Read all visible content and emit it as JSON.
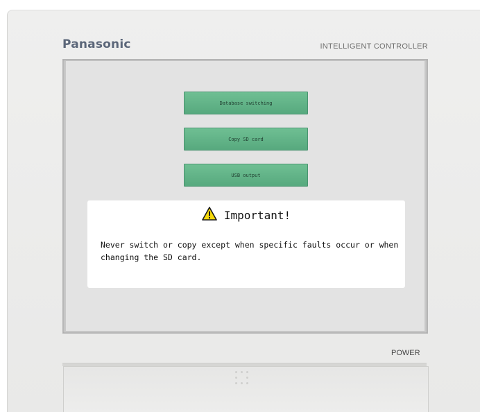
{
  "device": {
    "brand": "Panasonic",
    "model": "INTELLIGENT CONTROLLER",
    "power_label": "POWER",
    "power_led_color": "#62c94d"
  },
  "menu": {
    "buttons": [
      {
        "label": "Database switching"
      },
      {
        "label": "Copy SD card"
      },
      {
        "label": "USB output"
      }
    ],
    "button_color": "#5fb287"
  },
  "notice": {
    "icon": "warning-triangle-icon",
    "title": "Important!",
    "message": "Never switch or copy except when specific faults occur or when changing the SD card."
  }
}
